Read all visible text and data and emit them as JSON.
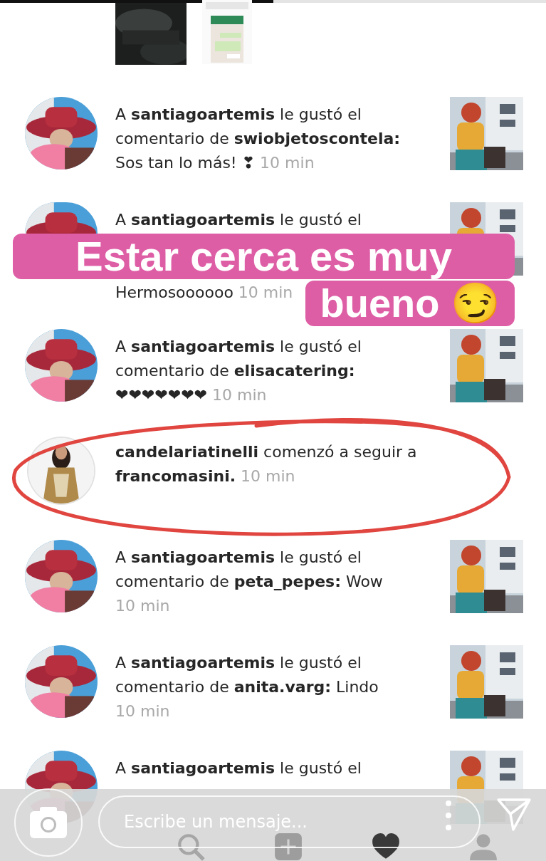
{
  "story_progress": {
    "level": 0.5
  },
  "notifications": [
    {
      "kind": "like",
      "lines": [
        "A **santiagoartemis** le gustó el",
        "comentario de **swiobjetoscontela:**",
        "Sos tan lo más! ❣"
      ],
      "time": "10 min"
    },
    {
      "kind": "like",
      "lines": [
        "A **santiagoartemis** le gustó el"
      ],
      "tail": "Hermosoooooo",
      "time": "10 min"
    },
    {
      "kind": "like",
      "lines": [
        "A **santiagoartemis** le gustó el",
        "comentario de **elisacatering:**",
        "❤❤❤❤❤❤❤"
      ],
      "time": "10 min"
    },
    {
      "kind": "follow",
      "lines": [
        "**candelariatinelli** comenzó a seguir a",
        "**francomasini.**"
      ],
      "time": "10 min"
    },
    {
      "kind": "like",
      "lines": [
        "A **santiagoartemis** le gustó el",
        "comentario de **peta_pepes:** Wow"
      ],
      "time": "10 min",
      "time_newline": true
    },
    {
      "kind": "like",
      "lines": [
        "A **santiagoartemis** le gustó el",
        "comentario de **anita.varg:** Lindo"
      ],
      "time": "10 min",
      "time_newline": true
    },
    {
      "kind": "like",
      "lines": [
        "A **santiagoartemis** le gustó el"
      ]
    }
  ],
  "sticker": {
    "lines": [
      "Estar cerca es muy",
      "bueno 😏"
    ]
  },
  "message_bar": {
    "placeholder": "Escribe un mensaje..."
  }
}
